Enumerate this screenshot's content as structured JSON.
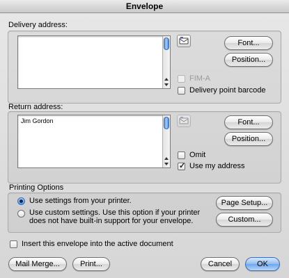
{
  "window": {
    "title": "Envelope"
  },
  "delivery": {
    "label": "Delivery address:",
    "text": "",
    "font_button": "Font...",
    "position_button": "Position...",
    "fim_label": "FIM-A",
    "barcode_label": "Delivery point barcode",
    "fim_checked": false,
    "barcode_checked": false
  },
  "return": {
    "label": "Return address:",
    "text": "Jim Gordon",
    "font_button": "Font...",
    "position_button": "Position...",
    "omit_label": "Omit",
    "use_my_address_label": "Use my address",
    "omit_checked": false,
    "use_my_address_checked": true
  },
  "printing": {
    "label": "Printing Options",
    "option1": "Use settings from your printer.",
    "option2": "Use custom settings. Use this option if your printer does not have built-in support for your envelope.",
    "selected": 1,
    "page_setup_button": "Page Setup...",
    "custom_button": "Custom..."
  },
  "insert": {
    "label": "Insert this envelope into the active document",
    "checked": false
  },
  "footer": {
    "mail_merge_button": "Mail Merge...",
    "print_button": "Print...",
    "cancel_button": "Cancel",
    "ok_button": "OK"
  },
  "colors": {
    "window_bg": "#dcdcdc",
    "accent": "#4d84cf"
  }
}
